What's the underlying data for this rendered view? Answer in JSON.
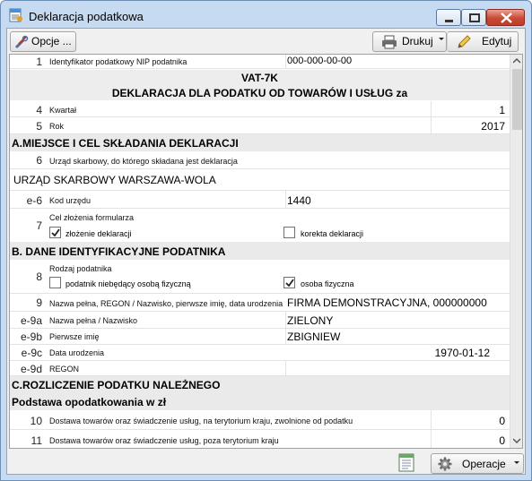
{
  "window": {
    "title": "Deklaracja podatkowa",
    "minimize_icon": "minimize-icon",
    "maximize_icon": "maximize-icon",
    "close_icon": "close-icon"
  },
  "toolbar": {
    "options_label": "Opcje ...",
    "print_label": "Drukuj",
    "edit_label": "Edytuj",
    "options_icon": "tools-icon",
    "print_icon": "printer-icon",
    "edit_icon": "pencil-icon"
  },
  "form": {
    "row1": {
      "num": "1",
      "label": "Identyfikator podatkowy NIP podatnika",
      "value": "000-000-00-00"
    },
    "header_code": "VAT-7K",
    "header_title": "DEKLARACJA DLA PODATKU OD TOWARÓW I USŁUG za",
    "row4": {
      "num": "4",
      "label": "Kwartał",
      "value": "1"
    },
    "row5": {
      "num": "5",
      "label": "Rok",
      "value": "2017"
    },
    "sectionA": "A.MIEJSCE I CEL SKŁADANIA DEKLARACJI",
    "row6": {
      "num": "6",
      "label": "Urząd skarbowy, do którego składana jest deklaracja"
    },
    "office_name": "URZĄD SKARBOWY WARSZAWA-WOLA",
    "row_e6": {
      "num": "e-6",
      "label": "Kod urzędu",
      "value": "1440"
    },
    "row7": {
      "num": "7",
      "label": "Cel złożenia formularza",
      "opt1": "złożenie deklaracji",
      "opt1_checked": true,
      "opt2": "korekta deklaracji",
      "opt2_checked": false
    },
    "sectionB": "B. DANE IDENTYFIKACYJNE PODATNIKA",
    "row8": {
      "num": "8",
      "label": "Rodzaj podatnika",
      "opt1": "podatnik niebędący osobą fizyczną",
      "opt1_checked": false,
      "opt2": "osoba fizyczna",
      "opt2_checked": true
    },
    "row9": {
      "num": "9",
      "label": "Nazwa pełna, REGON / Nazwisko, pierwsze imię, data urodzenia",
      "value": "FIRMA DEMONSTRACYJNA, 000000000"
    },
    "row_e9a": {
      "num": "e-9a",
      "label": "Nazwa pełna / Nazwisko",
      "value": "ZIELONY"
    },
    "row_e9b": {
      "num": "e-9b",
      "label": "Pierwsze imię",
      "value": "ZBIGNIEW"
    },
    "row_e9c": {
      "num": "e-9c",
      "label": "Data urodzenia",
      "value": "1970-01-12"
    },
    "row_e9d": {
      "num": "e-9d",
      "label": "REGON",
      "value": ""
    },
    "sectionC": "C.ROZLICZENIE PODATKU NALEŻNEGO",
    "subsectionC": "Podstawa opodatkowania w zł",
    "row10": {
      "num": "10",
      "label": "Dostawa towarów oraz świadczenie usług, na terytorium kraju, zwolnione od podatku",
      "value": "0"
    },
    "row11": {
      "num": "11",
      "label": "Dostawa towarów oraz świadczenie usług, poza terytorium kraju",
      "value": "0"
    }
  },
  "statusbar": {
    "operations_label": "Operacje",
    "notepad_icon": "notepad-icon",
    "gear_icon": "gear-icon"
  }
}
